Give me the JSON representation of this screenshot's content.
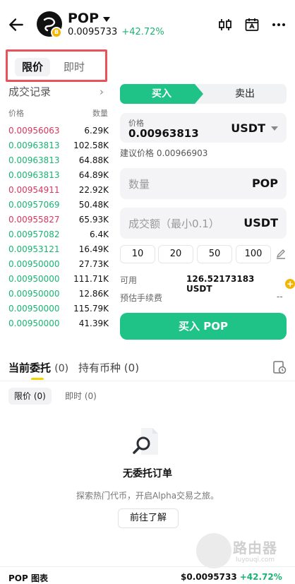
{
  "header": {
    "symbol": "POP",
    "price": "0.0095733",
    "change": "+42.72%"
  },
  "order_tabs": {
    "limit": "限价",
    "market": "即时"
  },
  "trades": {
    "title": "成交记录",
    "col_price": "价格",
    "col_qty": "数量",
    "rows": [
      {
        "price": "0.00956063",
        "qty": "6.29K",
        "side": "sell"
      },
      {
        "price": "0.00963813",
        "qty": "102.58K",
        "side": "buy"
      },
      {
        "price": "0.00963813",
        "qty": "64.88K",
        "side": "buy"
      },
      {
        "price": "0.00963813",
        "qty": "64.89K",
        "side": "buy"
      },
      {
        "price": "0.00954911",
        "qty": "22.92K",
        "side": "sell"
      },
      {
        "price": "0.00957069",
        "qty": "50.48K",
        "side": "buy"
      },
      {
        "price": "0.00955827",
        "qty": "65.93K",
        "side": "sell"
      },
      {
        "price": "0.00957082",
        "qty": "6.4K",
        "side": "buy"
      },
      {
        "price": "0.00953121",
        "qty": "16.49K",
        "side": "buy"
      },
      {
        "price": "0.00950000",
        "qty": "27.73K",
        "side": "buy"
      },
      {
        "price": "0.00950000",
        "qty": "111.71K",
        "side": "buy"
      },
      {
        "price": "0.00950000",
        "qty": "12.86K",
        "side": "buy"
      },
      {
        "price": "0.00950000",
        "qty": "115.79K",
        "side": "buy"
      },
      {
        "price": "0.00950000",
        "qty": "41.39K",
        "side": "buy"
      }
    ]
  },
  "trade_form": {
    "buy_label": "买入",
    "sell_label": "卖出",
    "price_label": "价格",
    "price_value": "0.00963813",
    "price_unit": "USDT",
    "suggest_label": "建议价格",
    "suggest_value": "0.00966903",
    "qty_placeholder": "数量",
    "qty_unit": "POP",
    "amount_placeholder": "成交额（最小0.1）",
    "amount_unit": "USDT",
    "quick_amounts": [
      "10",
      "20",
      "50",
      "100"
    ],
    "available_label": "可用",
    "available_value": "126.52173183 USDT",
    "fee_label": "预估手续费",
    "fee_value": "--",
    "submit_label": "买入 POP"
  },
  "orders": {
    "tab_open": "当前委托",
    "tab_open_count": "(0)",
    "tab_holdings": "持有币种",
    "tab_holdings_count": "(0)",
    "sub_limit": "限价 (0)",
    "sub_market": "即时 (0)",
    "empty_title": "无委托订单",
    "empty_desc": "探索热门代币，开启Alpha交易之旅。",
    "goto_label": "前往了解"
  },
  "watermark": {
    "main": "路由器",
    "sub": "luyouqi.com"
  },
  "footer": {
    "chart_label": "POP 图表",
    "price": "$0.0095733",
    "change": "+42.72%"
  },
  "colors": {
    "buy": "#20c387",
    "sell": "#d9365f",
    "up": "#19b473",
    "accent_yellow": "#f2b600",
    "highlight": "#e7525b"
  }
}
